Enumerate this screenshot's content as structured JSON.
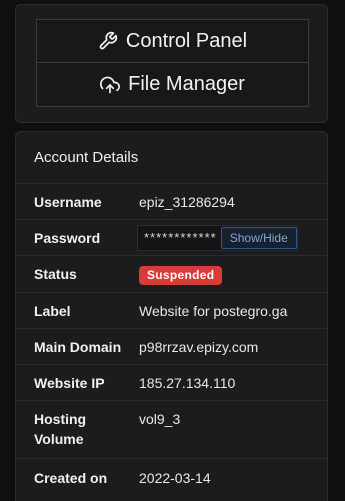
{
  "nav": {
    "control_panel_label": "Control Panel",
    "control_panel_icon": "wrench-icon",
    "file_manager_label": "File Manager",
    "file_manager_icon": "cloud-upload-icon"
  },
  "account": {
    "heading": "Account Details",
    "rows": {
      "username": {
        "label": "Username",
        "value": "epiz_31286294"
      },
      "password": {
        "label": "Password",
        "value": "************",
        "toggle_label": "Show/Hide"
      },
      "status": {
        "label": "Status",
        "value": "Suspended",
        "color": "#d93b3b"
      },
      "site_label": {
        "label": "Label",
        "value": "Website for postegro.ga"
      },
      "main_domain": {
        "label": "Main Domain",
        "value": "p98rrzav.epizy.com"
      },
      "website_ip": {
        "label": "Website IP",
        "value": "185.27.134.110"
      },
      "hosting_volume": {
        "label": "Hosting Volume",
        "value": "vol9_3"
      },
      "created_on": {
        "label": "Created on",
        "value": "2022-03-14"
      }
    }
  }
}
